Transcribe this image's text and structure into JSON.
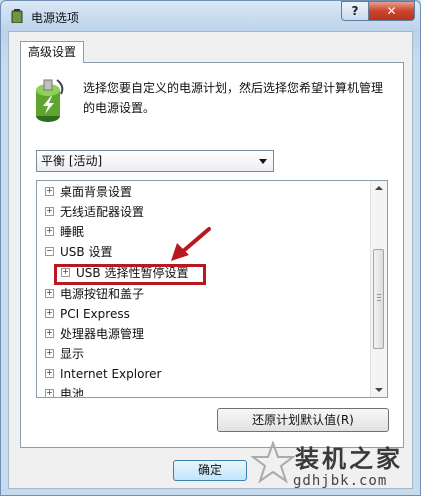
{
  "window": {
    "title": "电源选项",
    "help_label": "?",
    "close_label": "✕"
  },
  "tab": {
    "label": "高级设置"
  },
  "description": "选择您要自定义的电源计划，然后选择您希望计算机管理的电源设置。",
  "plan_select": {
    "value": "平衡 [活动]"
  },
  "tree": {
    "items": [
      {
        "label": "桌面背景设置",
        "expander": "+"
      },
      {
        "label": "无线适配器设置",
        "expander": "+"
      },
      {
        "label": "睡眠",
        "expander": "+"
      },
      {
        "label": "USB 设置",
        "expander": "−"
      },
      {
        "label": "USB 选择性暂停设置",
        "expander": "+"
      },
      {
        "label": "电源按钮和盖子",
        "expander": "+"
      },
      {
        "label": "PCI Express",
        "expander": "+"
      },
      {
        "label": "处理器电源管理",
        "expander": "+"
      },
      {
        "label": "显示",
        "expander": "+"
      },
      {
        "label": "Internet Explorer",
        "expander": "+"
      },
      {
        "label": "电池",
        "expander": "+"
      }
    ]
  },
  "buttons": {
    "restore": "还原计划默认值(R)",
    "ok": "确定"
  },
  "watermark": {
    "title": "装机之家",
    "url": "gdhjbk.com"
  },
  "colors": {
    "highlight": "#b8181f",
    "annotation_arrow": "#b8181f"
  }
}
